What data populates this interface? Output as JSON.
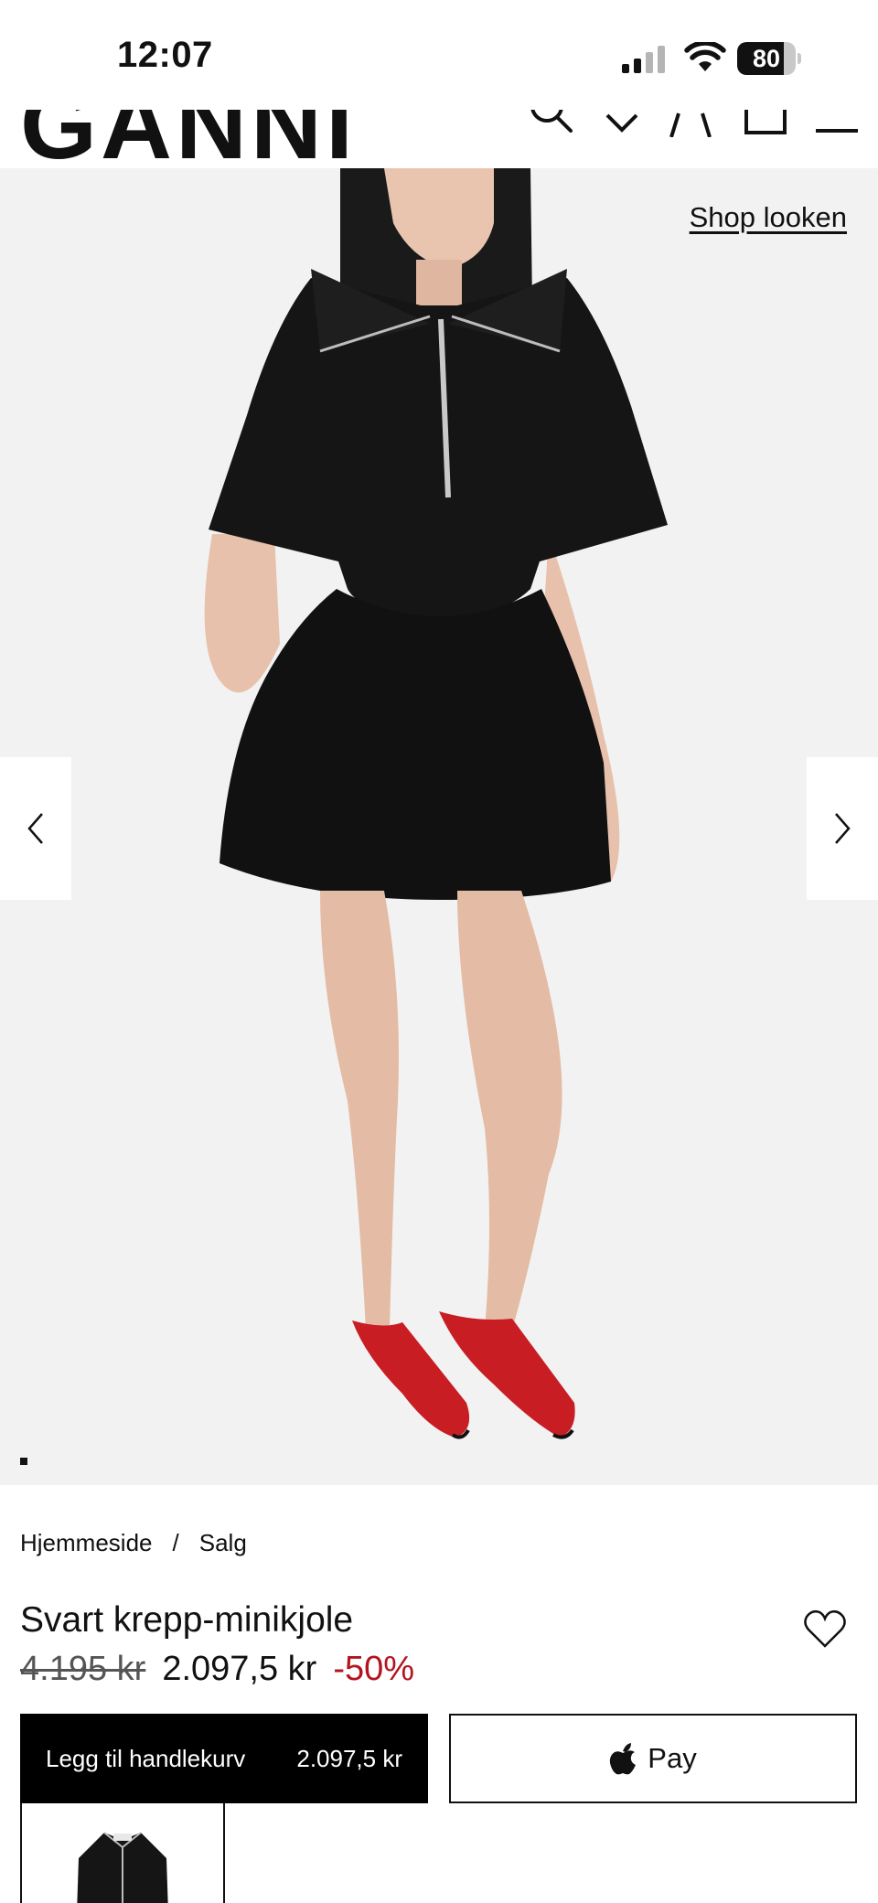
{
  "status_bar": {
    "time": "12:07",
    "battery_level": 80,
    "battery_text": "80"
  },
  "header": {
    "logo": "GANNI",
    "icons": [
      "search-icon",
      "chevron-down-icon",
      "account-icon",
      "bag-icon",
      "menu-icon"
    ]
  },
  "hero": {
    "shop_look_label": "Shop looken",
    "prev_icon": "chevron-left-icon",
    "next_icon": "chevron-right-icon"
  },
  "breadcrumb": {
    "items": [
      "Hjemmeside",
      "Salg"
    ],
    "separator": "/"
  },
  "product": {
    "title": "Svart krepp-minikjole",
    "price_old": "4.195 kr",
    "price_now": "2.097,5 kr",
    "discount": "-50%",
    "wishlist_icon": "heart-icon"
  },
  "actions": {
    "add_to_cart_label": "Legg til handlekurv",
    "add_to_cart_price": "2.097,5 kr",
    "apple_pay_label": "Pay"
  },
  "colors": {
    "discount": "#b3141e",
    "primary_button": "#000000",
    "hero_background": "#f2f2f2"
  }
}
